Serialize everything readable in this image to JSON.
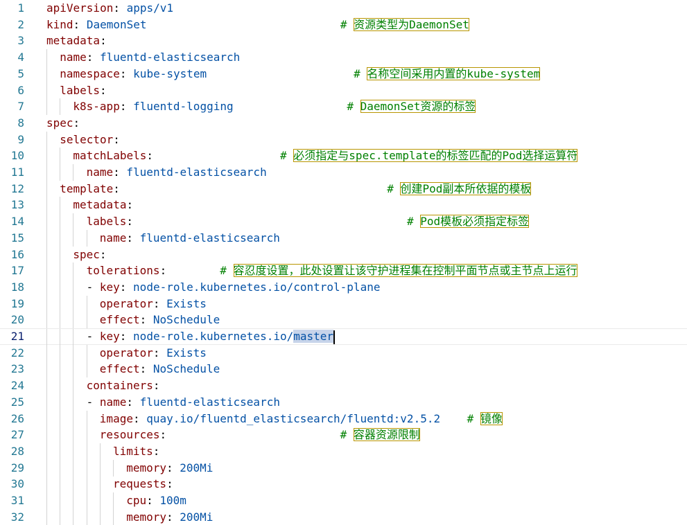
{
  "editor": {
    "current_line": 21,
    "lines": [
      {
        "n": "1",
        "key": "apiVersion",
        "val": "apps/v1"
      },
      {
        "n": "2",
        "key": "kind",
        "val": "DaemonSet",
        "cpad": "                             ",
        "hash": "# ",
        "comment": "资源类型为DaemonSet"
      },
      {
        "n": "3",
        "key": "metadata",
        "val": ""
      },
      {
        "n": "4",
        "key": "name",
        "val": "fluentd-elasticsearch"
      },
      {
        "n": "5",
        "key": "namespace",
        "val": "kube-system",
        "cpad": "                      ",
        "hash": "# ",
        "comment": "名称空间采用内置的kube-system"
      },
      {
        "n": "6",
        "key": "labels",
        "val": ""
      },
      {
        "n": "7",
        "key": "k8s-app",
        "val": "fluentd-logging",
        "cpad": "                 ",
        "hash": "# ",
        "comment": "DaemonSet资源的标签"
      },
      {
        "n": "8",
        "key": "spec",
        "val": ""
      },
      {
        "n": "9",
        "key": "selector",
        "val": ""
      },
      {
        "n": "10",
        "key": "matchLabels",
        "val": "",
        "cpad": "                   ",
        "hash": "# ",
        "comment": "必须指定与spec.template的标签匹配的Pod选择运算符"
      },
      {
        "n": "11",
        "key": "name",
        "val": "fluentd-elasticsearch"
      },
      {
        "n": "12",
        "key": "template",
        "val": "",
        "cpad": "                                        ",
        "hash": "# ",
        "comment": "创建Pod副本所依据的模板"
      },
      {
        "n": "13",
        "key": "metadata",
        "val": ""
      },
      {
        "n": "14",
        "key": "labels",
        "val": "",
        "cpad": "                                         ",
        "hash": "# ",
        "comment": "Pod模板必须指定标签"
      },
      {
        "n": "15",
        "key": "name",
        "val": "fluentd-elasticsearch"
      },
      {
        "n": "16",
        "key": "spec",
        "val": ""
      },
      {
        "n": "17",
        "key": "tolerations",
        "val": "",
        "cpad": "        ",
        "hash": "# ",
        "comment": "容忍度设置，此处设置让该守护进程集在控制平面节点或主节点上运行"
      },
      {
        "n": "18",
        "key": "key",
        "val": "node-role.kubernetes.io/control-plane"
      },
      {
        "n": "19",
        "key": "operator",
        "val": "Exists"
      },
      {
        "n": "20",
        "key": "effect",
        "val": "NoSchedule"
      },
      {
        "n": "21",
        "key": "key",
        "val": "node-role.kubernetes.io/",
        "sel": "master"
      },
      {
        "n": "22",
        "key": "operator",
        "val": "Exists"
      },
      {
        "n": "23",
        "key": "effect",
        "val": "NoSchedule"
      },
      {
        "n": "24",
        "key": "containers",
        "val": ""
      },
      {
        "n": "25",
        "key": "name",
        "val": "fluentd-elasticsearch"
      },
      {
        "n": "26",
        "key": "image",
        "val": "quay.io/fluentd_elasticsearch/fluentd:v2.5.2",
        "cpad": "    ",
        "hash": "# ",
        "comment": "镜像"
      },
      {
        "n": "27",
        "key": "resources",
        "val": "",
        "cpad": "                          ",
        "hash": "# ",
        "comment": "容器资源限制"
      },
      {
        "n": "28",
        "key": "limits",
        "val": ""
      },
      {
        "n": "29",
        "key": "memory",
        "val": "200Mi"
      },
      {
        "n": "30",
        "key": "requests",
        "val": ""
      },
      {
        "n": "31",
        "key": "cpu",
        "val": "100m"
      },
      {
        "n": "32",
        "key": "memory",
        "val": "200Mi"
      }
    ]
  }
}
